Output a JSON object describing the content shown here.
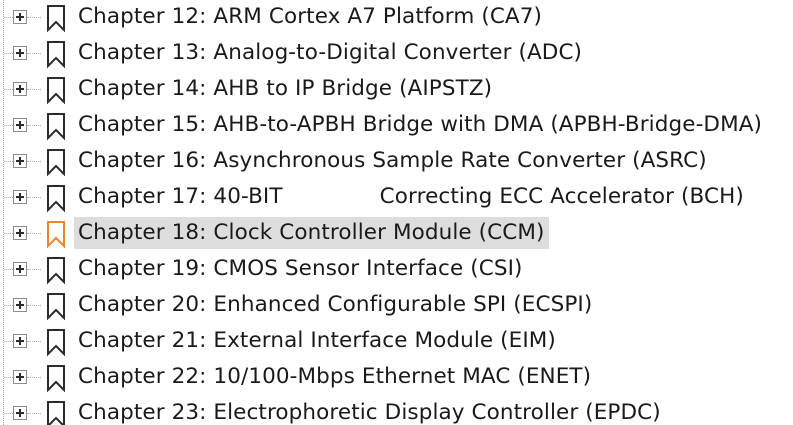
{
  "colors": {
    "bookmark_stroke": "#2b2b2b",
    "bookmark_selected_stroke": "#e8852c",
    "selection_background": "#dddddd",
    "text": "#1a1a1a"
  },
  "bookmarks": [
    {
      "label": "Chapter 12: ARM Cortex A7 Platform (CA7)",
      "icon": "bookmark-icon",
      "selected": false
    },
    {
      "label": "Chapter 13: Analog-to-Digital Converter (ADC)",
      "icon": "bookmark-icon",
      "selected": false
    },
    {
      "label": "Chapter 14: AHB to IP Bridge (AIPSTZ)",
      "icon": "bookmark-icon",
      "selected": false
    },
    {
      "label": "Chapter 15: AHB-to-APBH Bridge with DMA (APBH-Bridge-DMA)",
      "icon": "bookmark-icon",
      "selected": false
    },
    {
      "label": "Chapter 16: Asynchronous Sample Rate Converter (ASRC)",
      "icon": "bookmark-icon",
      "selected": false
    },
    {
      "label": "Chapter 17: 40-BIT              Correcting ECC Accelerator (BCH)",
      "icon": "bookmark-icon",
      "selected": false
    },
    {
      "label": "Chapter 18: Clock Controller Module (CCM)",
      "icon": "bookmark-icon",
      "selected": true
    },
    {
      "label": "Chapter 19: CMOS Sensor Interface (CSI)",
      "icon": "bookmark-icon",
      "selected": false
    },
    {
      "label": "Chapter 20: Enhanced Configurable SPI (ECSPI)",
      "icon": "bookmark-icon",
      "selected": false
    },
    {
      "label": "Chapter 21: External Interface Module (EIM)",
      "icon": "bookmark-icon",
      "selected": false
    },
    {
      "label": "Chapter 22: 10/100-Mbps Ethernet MAC (ENET)",
      "icon": "bookmark-icon",
      "selected": false
    },
    {
      "label": "Chapter 23: Electrophoretic Display Controller (EPDC)",
      "icon": "bookmark-icon",
      "selected": false
    }
  ]
}
